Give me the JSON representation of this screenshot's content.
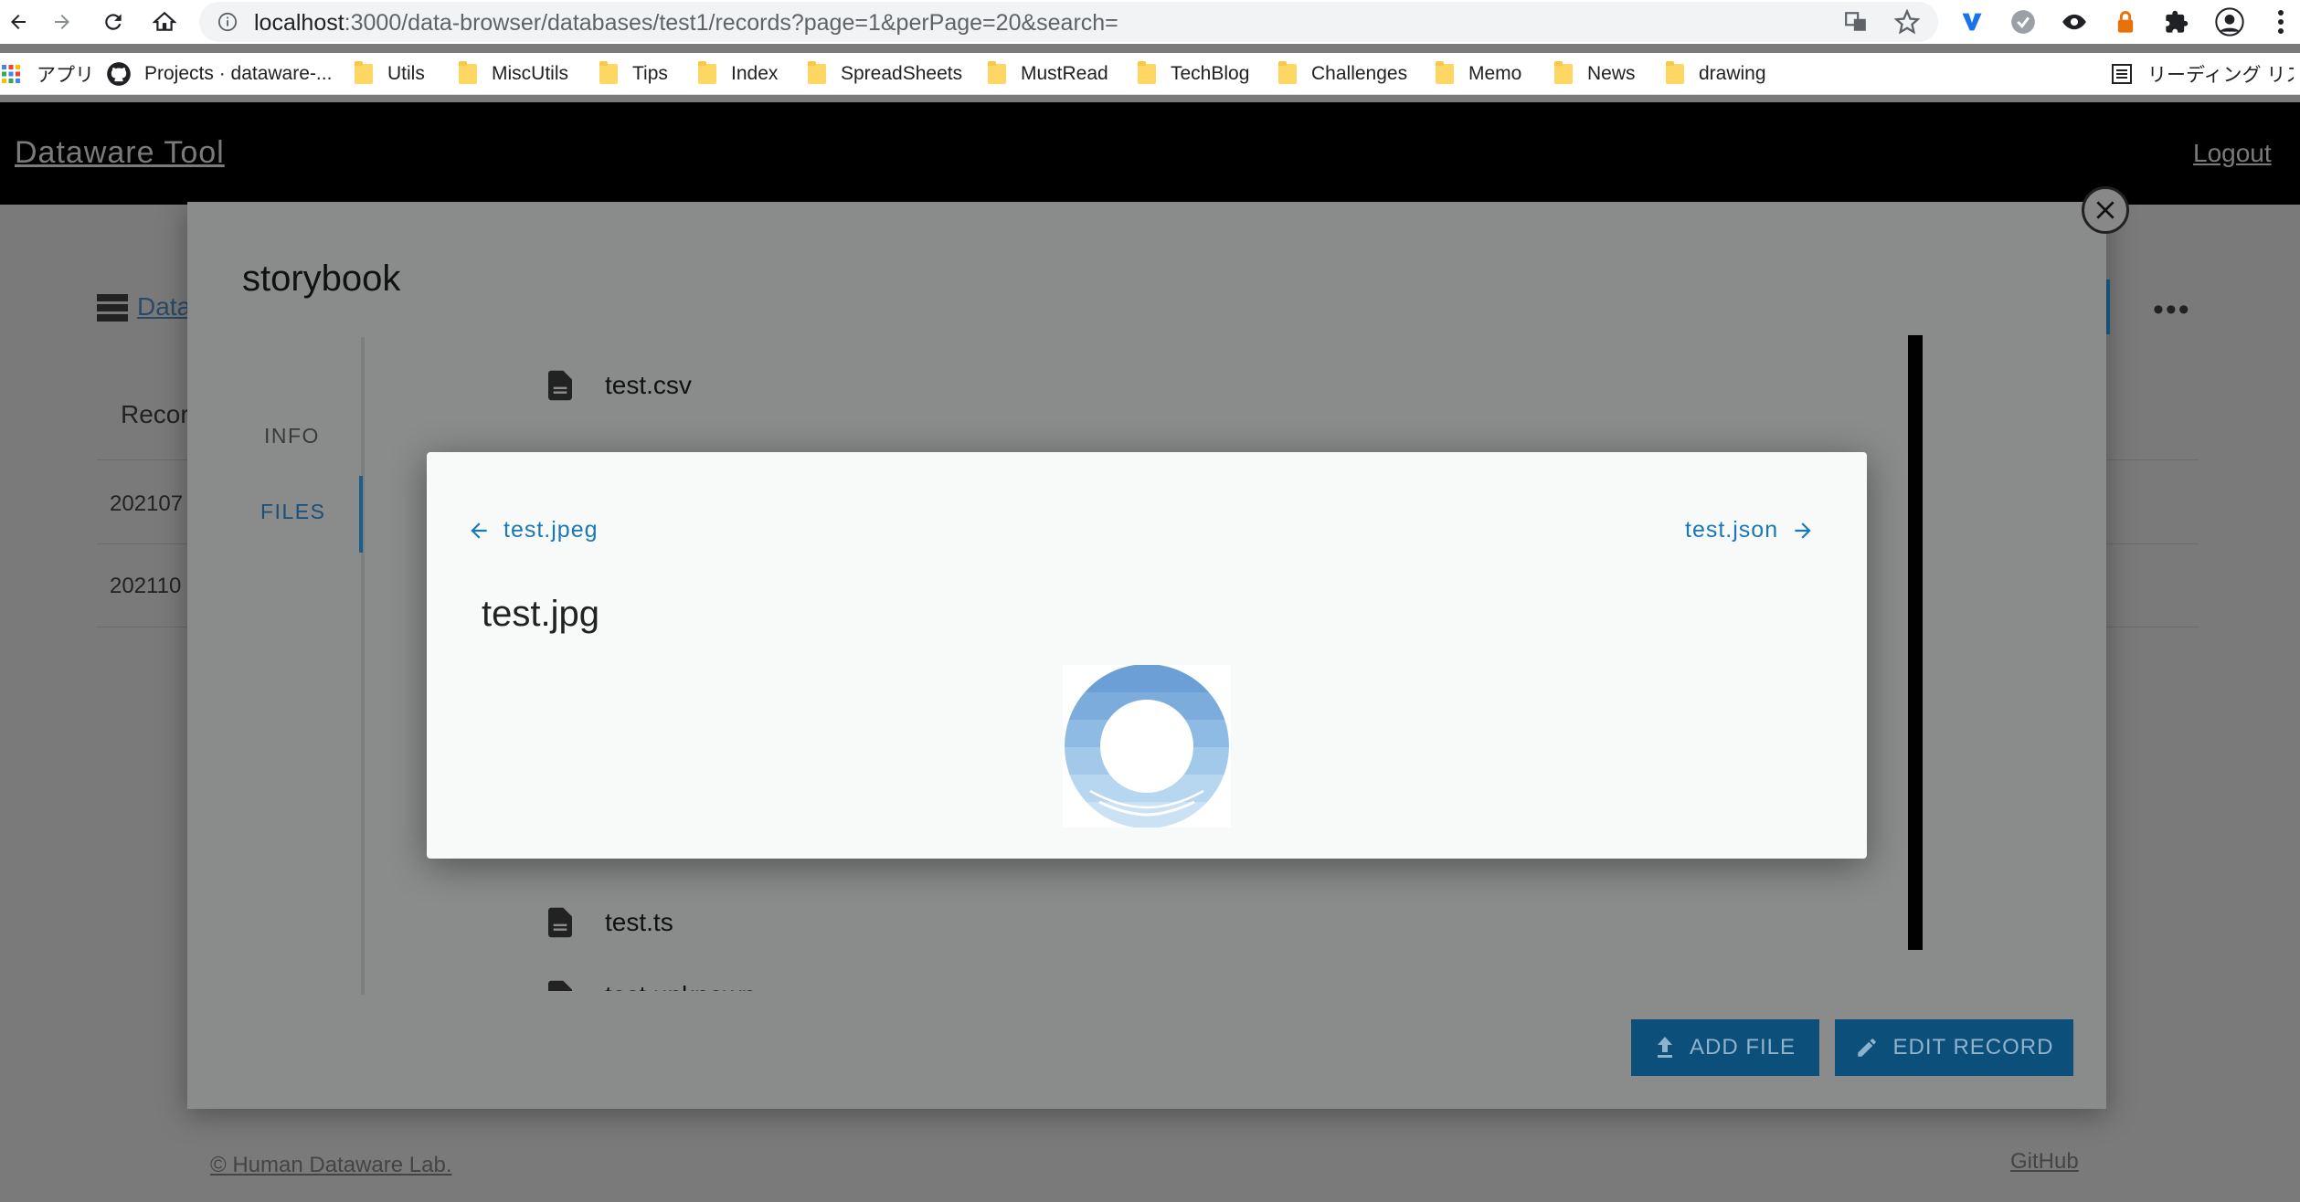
{
  "browser": {
    "url_host": "localhost",
    "url_path": ":3000/data-browser/databases/test1/records?page=1&perPage=20&search=",
    "bookmarks": [
      {
        "label": "アプリ",
        "icon": "apps-grid-icon"
      },
      {
        "label": "Projects · dataware-...",
        "icon": "github-icon"
      },
      {
        "label": "Utils",
        "icon": "folder-icon"
      },
      {
        "label": "MiscUtils",
        "icon": "folder-icon"
      },
      {
        "label": "Tips",
        "icon": "folder-icon"
      },
      {
        "label": "Index",
        "icon": "folder-icon"
      },
      {
        "label": "SpreadSheets",
        "icon": "folder-icon"
      },
      {
        "label": "MustRead",
        "icon": "folder-icon"
      },
      {
        "label": "TechBlog",
        "icon": "folder-icon"
      },
      {
        "label": "Challenges",
        "icon": "folder-icon"
      },
      {
        "label": "Memo",
        "icon": "folder-icon"
      },
      {
        "label": "News",
        "icon": "folder-icon"
      },
      {
        "label": "drawing",
        "icon": "folder-icon"
      }
    ],
    "reading_list": "リーディング リスト"
  },
  "app": {
    "title": "Dataware Tool",
    "logout": "Logout",
    "breadcrumb_partial": "Data",
    "records_heading_partial": "Recor",
    "row1_partial": "202107",
    "row2_partial": "202110",
    "footer_copyright": "© Human Dataware Lab.",
    "footer_github": "GitHub"
  },
  "record_modal": {
    "title": "storybook",
    "tabs": [
      {
        "label": "INFO",
        "active": false
      },
      {
        "label": "FILES",
        "active": true
      }
    ],
    "files": [
      {
        "name": "test.csv"
      },
      {
        "name": "test.ts"
      },
      {
        "name": "test.unknown"
      }
    ],
    "add_file_label": "ADD FILE",
    "edit_record_label": "EDIT RECORD"
  },
  "preview_modal": {
    "prev_file": "test.jpeg",
    "next_file": "test.json",
    "file_name": "test.jpg"
  },
  "colors": {
    "accent": "#1a78b4",
    "button_bg": "#0c4f7a",
    "header_bg": "#000000"
  }
}
